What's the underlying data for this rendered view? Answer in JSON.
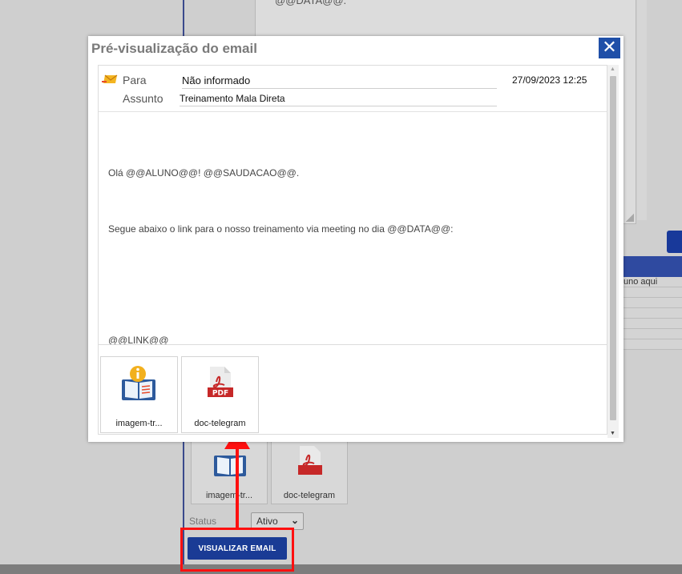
{
  "background": {
    "editor_snippet": "@@DATA@@.",
    "table_row_text": "uno aqui",
    "attachments": [
      {
        "name": "imagem-tr...",
        "icon": "book-info-icon"
      },
      {
        "name": "doc-telegram",
        "icon": "pdf-icon"
      }
    ],
    "status_label": "Status",
    "status_value": "Ativo",
    "preview_button": "VISUALIZAR EMAIL"
  },
  "modal": {
    "title": "Pré-visualização do email",
    "close_glyph": "✕",
    "header": {
      "to_label": "Para",
      "to_value": "Não informado",
      "subject_label": "Assunto",
      "subject_value": "Treinamento Mala Direta",
      "date": "27/09/2023 12:25"
    },
    "body_lines": [
      "Olá @@ALUNO@@! @@SAUDACAO@@.",
      "Segue abaixo o link para o nosso treinamento via meeting no dia @@DATA@@:",
      "@@LINK@@"
    ],
    "attachments": [
      {
        "name": "imagem-tr...",
        "icon": "book-info-icon"
      },
      {
        "name": "doc-telegram",
        "icon": "pdf-icon"
      }
    ],
    "pdf_badge": "PDF"
  },
  "colors": {
    "primary_blue": "#1a3b95",
    "close_blue": "#1f4fa8",
    "annotation_red": "#ff1010",
    "pdf_red": "#c62828"
  }
}
